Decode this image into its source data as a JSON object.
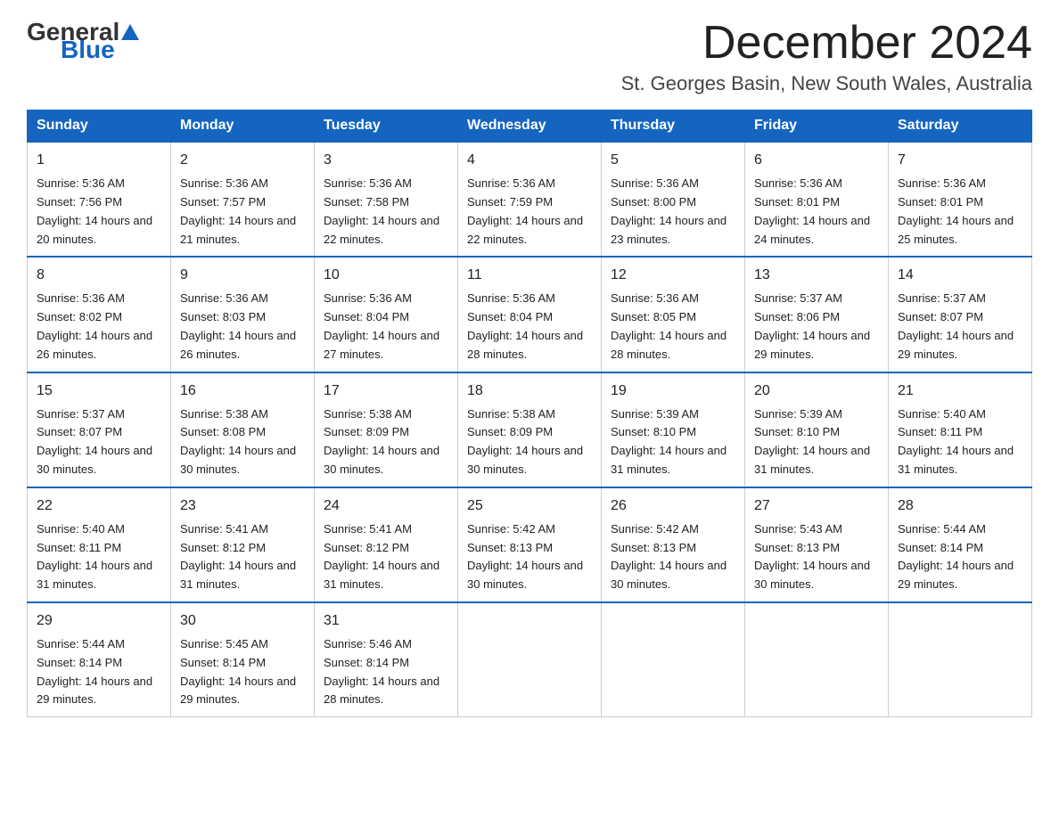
{
  "logo": {
    "general": "General",
    "blue": "Blue"
  },
  "title": "December 2024",
  "subtitle": "St. Georges Basin, New South Wales, Australia",
  "headers": [
    "Sunday",
    "Monday",
    "Tuesday",
    "Wednesday",
    "Thursday",
    "Friday",
    "Saturday"
  ],
  "weeks": [
    [
      {
        "num": "1",
        "sunrise": "5:36 AM",
        "sunset": "7:56 PM",
        "daylight": "14 hours and 20 minutes."
      },
      {
        "num": "2",
        "sunrise": "5:36 AM",
        "sunset": "7:57 PM",
        "daylight": "14 hours and 21 minutes."
      },
      {
        "num": "3",
        "sunrise": "5:36 AM",
        "sunset": "7:58 PM",
        "daylight": "14 hours and 22 minutes."
      },
      {
        "num": "4",
        "sunrise": "5:36 AM",
        "sunset": "7:59 PM",
        "daylight": "14 hours and 22 minutes."
      },
      {
        "num": "5",
        "sunrise": "5:36 AM",
        "sunset": "8:00 PM",
        "daylight": "14 hours and 23 minutes."
      },
      {
        "num": "6",
        "sunrise": "5:36 AM",
        "sunset": "8:01 PM",
        "daylight": "14 hours and 24 minutes."
      },
      {
        "num": "7",
        "sunrise": "5:36 AM",
        "sunset": "8:01 PM",
        "daylight": "14 hours and 25 minutes."
      }
    ],
    [
      {
        "num": "8",
        "sunrise": "5:36 AM",
        "sunset": "8:02 PM",
        "daylight": "14 hours and 26 minutes."
      },
      {
        "num": "9",
        "sunrise": "5:36 AM",
        "sunset": "8:03 PM",
        "daylight": "14 hours and 26 minutes."
      },
      {
        "num": "10",
        "sunrise": "5:36 AM",
        "sunset": "8:04 PM",
        "daylight": "14 hours and 27 minutes."
      },
      {
        "num": "11",
        "sunrise": "5:36 AM",
        "sunset": "8:04 PM",
        "daylight": "14 hours and 28 minutes."
      },
      {
        "num": "12",
        "sunrise": "5:36 AM",
        "sunset": "8:05 PM",
        "daylight": "14 hours and 28 minutes."
      },
      {
        "num": "13",
        "sunrise": "5:37 AM",
        "sunset": "8:06 PM",
        "daylight": "14 hours and 29 minutes."
      },
      {
        "num": "14",
        "sunrise": "5:37 AM",
        "sunset": "8:07 PM",
        "daylight": "14 hours and 29 minutes."
      }
    ],
    [
      {
        "num": "15",
        "sunrise": "5:37 AM",
        "sunset": "8:07 PM",
        "daylight": "14 hours and 30 minutes."
      },
      {
        "num": "16",
        "sunrise": "5:38 AM",
        "sunset": "8:08 PM",
        "daylight": "14 hours and 30 minutes."
      },
      {
        "num": "17",
        "sunrise": "5:38 AM",
        "sunset": "8:09 PM",
        "daylight": "14 hours and 30 minutes."
      },
      {
        "num": "18",
        "sunrise": "5:38 AM",
        "sunset": "8:09 PM",
        "daylight": "14 hours and 30 minutes."
      },
      {
        "num": "19",
        "sunrise": "5:39 AM",
        "sunset": "8:10 PM",
        "daylight": "14 hours and 31 minutes."
      },
      {
        "num": "20",
        "sunrise": "5:39 AM",
        "sunset": "8:10 PM",
        "daylight": "14 hours and 31 minutes."
      },
      {
        "num": "21",
        "sunrise": "5:40 AM",
        "sunset": "8:11 PM",
        "daylight": "14 hours and 31 minutes."
      }
    ],
    [
      {
        "num": "22",
        "sunrise": "5:40 AM",
        "sunset": "8:11 PM",
        "daylight": "14 hours and 31 minutes."
      },
      {
        "num": "23",
        "sunrise": "5:41 AM",
        "sunset": "8:12 PM",
        "daylight": "14 hours and 31 minutes."
      },
      {
        "num": "24",
        "sunrise": "5:41 AM",
        "sunset": "8:12 PM",
        "daylight": "14 hours and 31 minutes."
      },
      {
        "num": "25",
        "sunrise": "5:42 AM",
        "sunset": "8:13 PM",
        "daylight": "14 hours and 30 minutes."
      },
      {
        "num": "26",
        "sunrise": "5:42 AM",
        "sunset": "8:13 PM",
        "daylight": "14 hours and 30 minutes."
      },
      {
        "num": "27",
        "sunrise": "5:43 AM",
        "sunset": "8:13 PM",
        "daylight": "14 hours and 30 minutes."
      },
      {
        "num": "28",
        "sunrise": "5:44 AM",
        "sunset": "8:14 PM",
        "daylight": "14 hours and 29 minutes."
      }
    ],
    [
      {
        "num": "29",
        "sunrise": "5:44 AM",
        "sunset": "8:14 PM",
        "daylight": "14 hours and 29 minutes."
      },
      {
        "num": "30",
        "sunrise": "5:45 AM",
        "sunset": "8:14 PM",
        "daylight": "14 hours and 29 minutes."
      },
      {
        "num": "31",
        "sunrise": "5:46 AM",
        "sunset": "8:14 PM",
        "daylight": "14 hours and 28 minutes."
      },
      null,
      null,
      null,
      null
    ]
  ],
  "labels": {
    "sunrise": "Sunrise:",
    "sunset": "Sunset:",
    "daylight": "Daylight:"
  }
}
